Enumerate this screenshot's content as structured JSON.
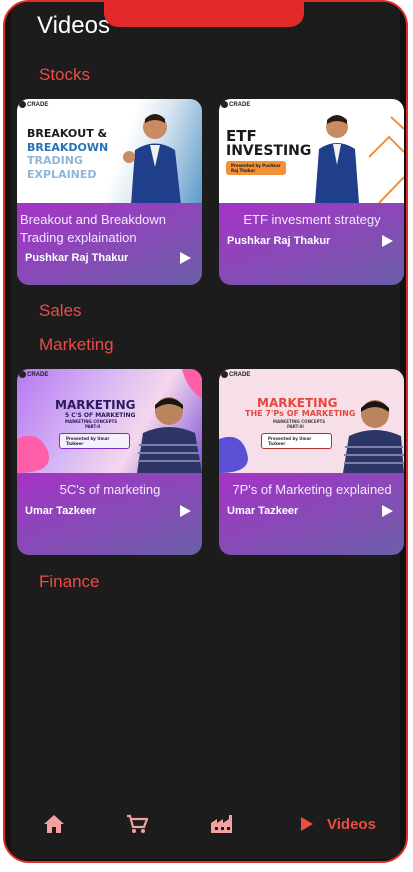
{
  "header": {
    "title": "Videos"
  },
  "sections": [
    {
      "name": "Stocks"
    },
    {
      "name": "Sales"
    },
    {
      "name": "Marketing"
    },
    {
      "name": "Finance"
    }
  ],
  "cards": [
    {
      "title": "Breakout and Breakdown Trading explaination",
      "author": "Pushkar Raj Thakur",
      "brand": "CRADE",
      "thumb_lines": [
        "BREAKOUT &",
        "BREAKDOWN",
        "TRADING",
        "EXPLAINED"
      ]
    },
    {
      "title": "ETF invesment strategy",
      "author": "Pushkar Raj Thakur",
      "brand": "CRADE",
      "thumb_lines": [
        "ETF",
        "INVESTING",
        "Presented by Pushkar Raj Thakur"
      ]
    },
    {
      "title": "5C's of marketing",
      "author": "Umar Tazkeer",
      "brand": "CRADE",
      "thumb_lines": [
        "MARKETING",
        "5 C'S OF MARKETING",
        "MARKETING CONCEPTS",
        "PART-II",
        "Presented by Umar Tazkeer"
      ]
    },
    {
      "title": "7P's of Marketing explained",
      "author": "Umar Tazkeer",
      "brand": "CRADE",
      "thumb_lines": [
        "MARKETING",
        "THE 7'Ps OF MARKETING",
        "MARKETING CONCEPTS",
        "PART-III",
        "Presented by Umar Tazkeer"
      ]
    }
  ],
  "nav": {
    "items": [
      {
        "icon": "home-icon"
      },
      {
        "icon": "cart-icon"
      },
      {
        "icon": "factory-icon"
      },
      {
        "icon": "play-icon",
        "label": "Videos",
        "active": true
      }
    ]
  },
  "colors": {
    "accent": "#ee4b45",
    "frame": "#e22a2a",
    "background": "#1c1c1c"
  }
}
